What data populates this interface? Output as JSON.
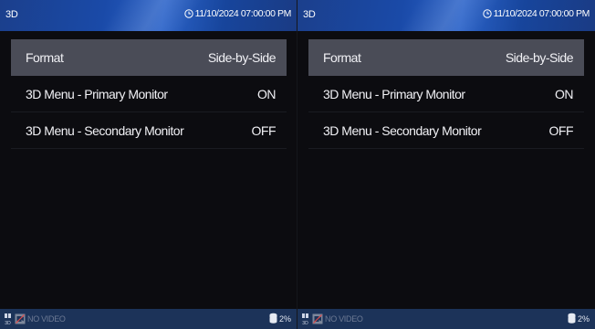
{
  "panes": [
    {
      "header": {
        "title": "3D",
        "datetime": "11/10/2024 07:00:00 PM"
      },
      "menu": [
        {
          "label": "Format",
          "value": "Side-by-Side",
          "selected": true
        },
        {
          "label": "3D Menu - Primary Monitor",
          "value": "ON"
        },
        {
          "label": "3D Menu - Secondary Monitor",
          "value": "OFF"
        }
      ],
      "footer": {
        "video_status": "NO VIDEO",
        "storage_percent": "2%"
      }
    },
    {
      "header": {
        "title": "3D",
        "datetime": "11/10/2024 07:00:00 PM"
      },
      "menu": [
        {
          "label": "Format",
          "value": "Side-by-Side",
          "selected": true
        },
        {
          "label": "3D Menu - Primary Monitor",
          "value": "ON"
        },
        {
          "label": "3D Menu - Secondary Monitor",
          "value": "OFF"
        }
      ],
      "footer": {
        "video_status": "NO VIDEO",
        "storage_percent": "2%"
      }
    }
  ],
  "icons": {
    "clock": "clock-icon",
    "mode": "3d-mode-icon",
    "no_video": "no-video-icon",
    "storage": "storage-icon"
  },
  "colors": {
    "header_blue": "#1a4aa8",
    "selected_row": "#4a4c57",
    "footer_blue": "#1c3359",
    "background": "#0c0c10"
  }
}
